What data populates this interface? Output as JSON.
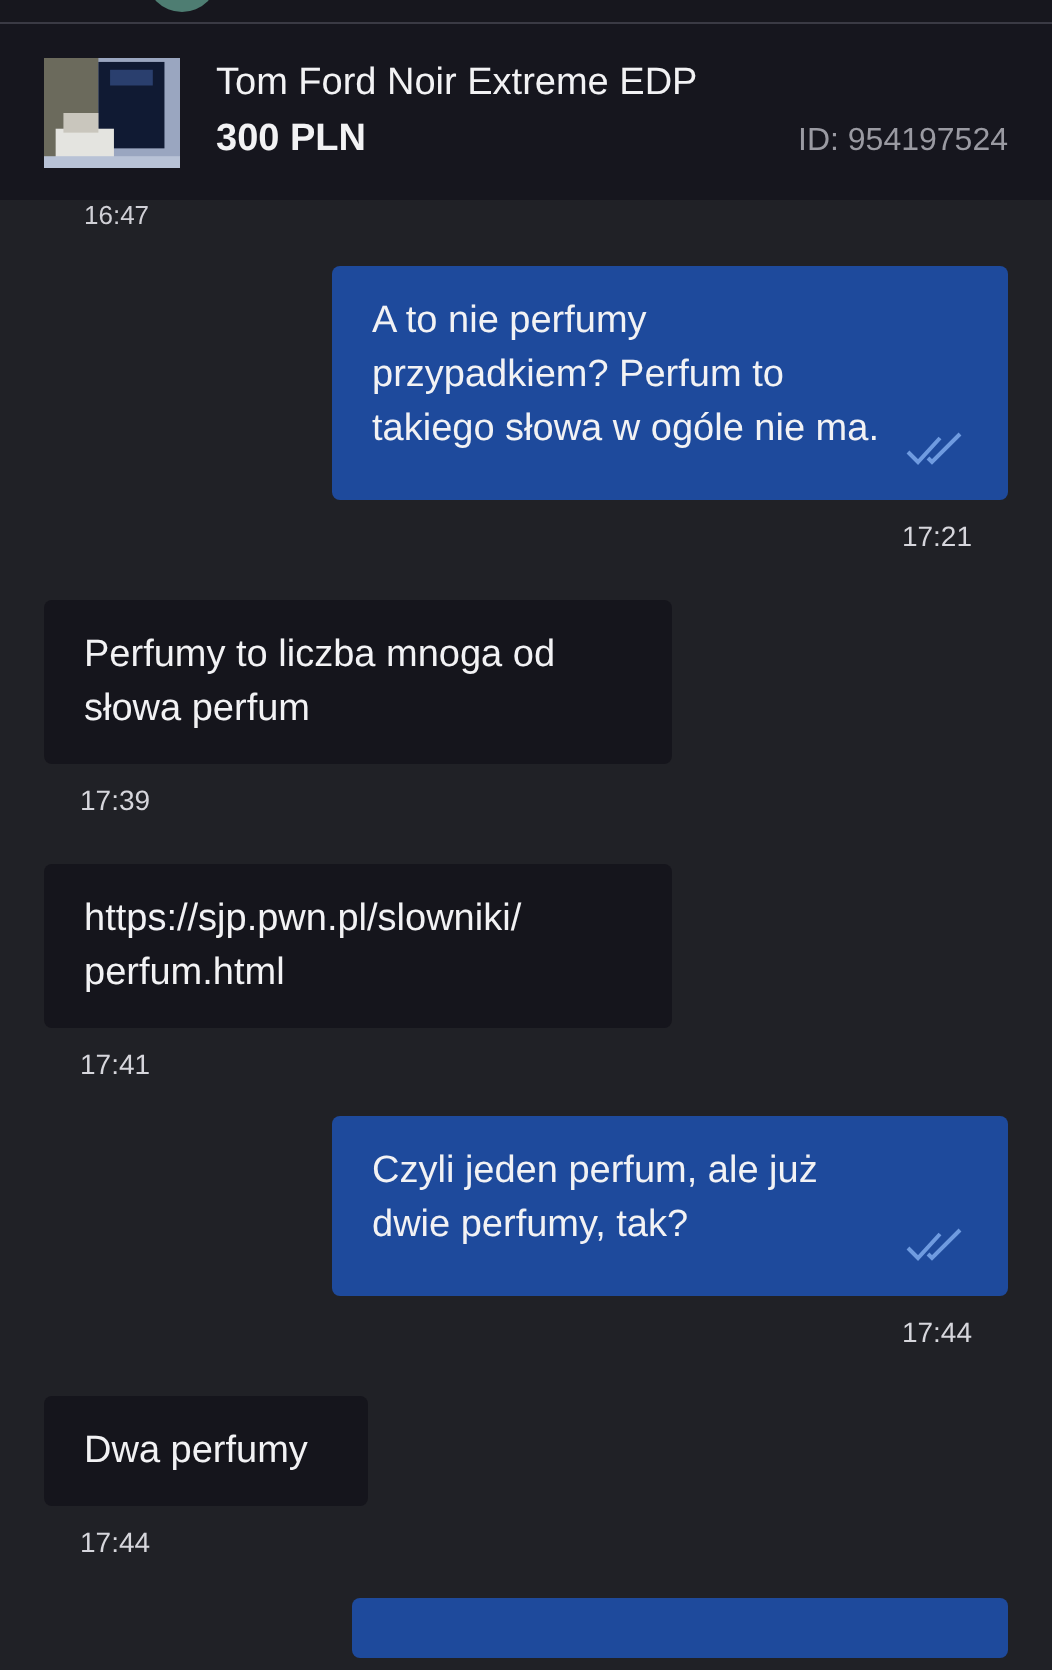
{
  "listing": {
    "title": "Tom Ford Noir Extreme EDP",
    "price": "300 PLN",
    "id": "ID: 954197524"
  },
  "top_time": "16:47",
  "messages": [
    {
      "kind": "out",
      "text": "A to nie perfumy przypadkiem? Perfum to takiego słowa w ogóle nie ma.",
      "time": "17:21",
      "read": true
    },
    {
      "kind": "in",
      "text": "Perfumy to liczba mnoga od słowa perfum",
      "time": "17:39"
    },
    {
      "kind": "in",
      "text": "https://sjp.pwn.pl/slowniki/ perfum.html",
      "time": "17:41"
    },
    {
      "kind": "out",
      "text": "Czyli jeden perfum, ale już dwie perfumy, tak?",
      "time": "17:44",
      "read": true
    },
    {
      "kind": "in",
      "text": "Dwa perfumy",
      "time": "17:44"
    },
    {
      "kind": "cut"
    }
  ]
}
